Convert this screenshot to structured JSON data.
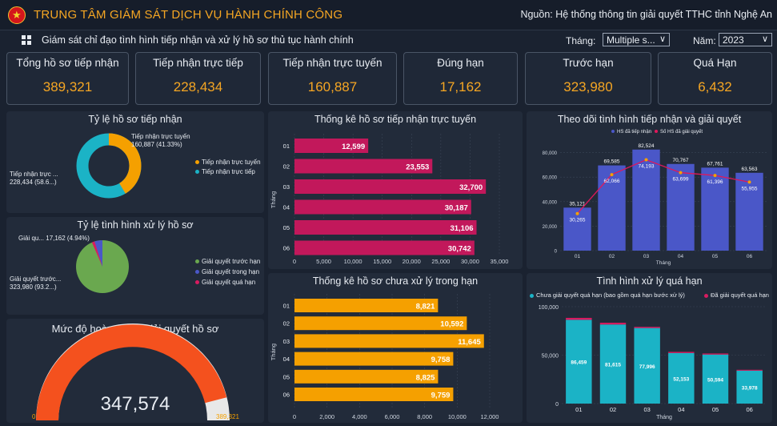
{
  "header": {
    "title": "TRUNG TÂM GIÁM SÁT DỊCH VỤ HÀNH CHÍNH CÔNG",
    "source": "Nguồn: Hệ thống thông tin giải quyết TTHC tỉnh Nghệ An",
    "logo_glyph": "★"
  },
  "subbar": {
    "subtitle": "Giám sát chỉ đạo tình hình tiếp nhận và xử lý hồ sơ thủ tục hành chính",
    "month_label": "Tháng:",
    "month_value": "Multiple s...",
    "year_label": "Năm:",
    "year_value": "2023",
    "chevron": "∨"
  },
  "kpis": [
    {
      "label": "Tổng hồ sơ tiếp nhận",
      "value": "389,321"
    },
    {
      "label": "Tiếp nhận trực tiếp",
      "value": "228,434"
    },
    {
      "label": "Tiếp nhận trực tuyến",
      "value": "160,887"
    },
    {
      "label": "Đúng hạn",
      "value": "17,162"
    },
    {
      "label": "Trước hạn",
      "value": "323,980"
    },
    {
      "label": "Quá Hạn",
      "value": "6,432"
    }
  ],
  "donut": {
    "title": "Tỷ lệ hồ sơ tiếp nhận",
    "label_online": "Tiếp nhận trực tuyến\n160,887 (41.33%)",
    "label_direct": "Tiếp nhận trực ...\n228,434 (58.6...)",
    "legend": [
      "Tiếp nhận trực tuyến",
      "Tiếp nhận trực tiếp"
    ]
  },
  "pie": {
    "title": "Tỷ lệ tình hình xử lý hồ sơ",
    "label_ontime": "Giải qu... 17,162 (4.94%)",
    "label_early": "Giải quyết trước...\n323,980 (93.2...)",
    "legend": [
      "Giải quyết trước hạn",
      "Giải quyết trong hạn",
      "Giải quyết quá hạn"
    ]
  },
  "gauge": {
    "title": "Mức độ hoàn thành giải quyết hồ sơ",
    "value": "347,574",
    "min": "0",
    "max": "389,321"
  },
  "chart_data": [
    {
      "type": "bar",
      "title": "Thống kê hồ sơ tiếp nhận trực tuyến",
      "ylabel": "Tháng",
      "categories": [
        "01",
        "02",
        "03",
        "04",
        "05",
        "06"
      ],
      "values": [
        12599,
        23553,
        32700,
        30187,
        31106,
        30742
      ],
      "value_labels": [
        "12,599",
        "23,553",
        "32,700",
        "30,187",
        "31,106",
        "30,742"
      ],
      "xlim": [
        0,
        35000
      ],
      "ticks": [
        "0",
        "5,000",
        "10,000",
        "15,000",
        "20,000",
        "25,000",
        "30,000",
        "35,000"
      ],
      "color": "#c2185b"
    },
    {
      "type": "bar",
      "title": "Thống kê hồ sơ chưa xử lý trong hạn",
      "ylabel": "Tháng",
      "categories": [
        "01",
        "02",
        "03",
        "04",
        "05",
        "06"
      ],
      "values": [
        8821,
        10592,
        11645,
        9758,
        8825,
        9759
      ],
      "value_labels": [
        "8,821",
        "10,592",
        "11,645",
        "9,758",
        "8,825",
        "9,759"
      ],
      "xlim": [
        0,
        12000
      ],
      "ticks": [
        "0",
        "2,000",
        "4,000",
        "6,000",
        "8,000",
        "10,000",
        "12,000"
      ],
      "color": "#f5a000"
    },
    {
      "type": "bar",
      "title": "Theo dõi tình hình tiếp nhận và giải quyết",
      "xlabel": "Tháng",
      "categories": [
        "01",
        "02",
        "03",
        "04",
        "05",
        "06"
      ],
      "series": [
        {
          "name": "HS đã tiếp nhận",
          "values": [
            35121,
            69585,
            82524,
            70767,
            67761,
            63563
          ],
          "labels": [
            "35,121",
            "69,585",
            "82,524",
            "70,767",
            "67,761",
            "63,563"
          ],
          "color": "#4a57c8"
        },
        {
          "name": "Số HS đã giải quyết",
          "values": [
            30265,
            62066,
            74193,
            63699,
            61396,
            55955
          ],
          "labels": [
            "30,265",
            "62,066",
            "74,193",
            "63,699",
            "61,396",
            "55,955"
          ],
          "color": "#e0185b"
        }
      ],
      "ylim": [
        0,
        85000
      ],
      "ticks": [
        "0",
        "20,000",
        "40,000",
        "60,000",
        "80,000"
      ]
    },
    {
      "type": "bar",
      "title": "Tình hình xử lý quá hạn",
      "xlabel": "Tháng",
      "categories": [
        "01",
        "02",
        "03",
        "04",
        "05",
        "06"
      ],
      "series": [
        {
          "name": "Chưa giải quyết quá hạn (bao gồm quá hạn bước xử lý)",
          "values": [
            86459,
            81615,
            77996,
            52153,
            50594,
            33978
          ],
          "labels": [
            "86,459",
            "81,615",
            "77,996",
            "52,153",
            "50,594",
            "33,978"
          ],
          "color": "#1bb3c6"
        },
        {
          "name": "Đã giải quyết quá hạn",
          "values": [
            2000,
            1800,
            1200,
            1200,
            1100,
            900
          ],
          "color": "#d81b60"
        }
      ],
      "ylim": [
        0,
        100000
      ],
      "ticks": [
        "0",
        "50,000",
        "100,000"
      ]
    }
  ]
}
